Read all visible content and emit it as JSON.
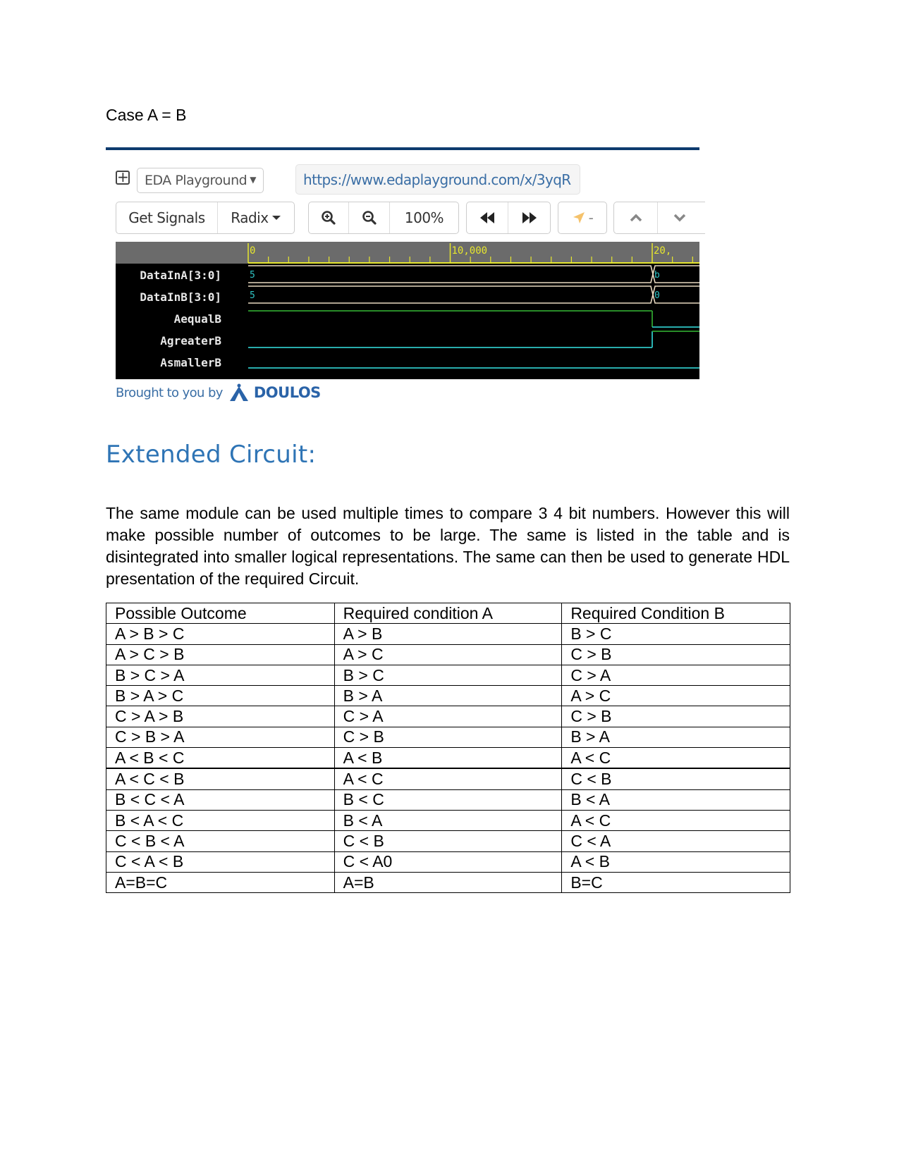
{
  "case_title": "Case A = B",
  "eda": {
    "menu_icon": "expand-plus-icon",
    "site_select": {
      "value": "EDA Playground",
      "caret": "▼"
    },
    "url": "https://www.edaplayground.com/x/3yqR",
    "toolbar": {
      "get_signals": "Get Signals",
      "radix": "Radix",
      "zoom_in_icon": "zoom-in-icon",
      "zoom_out_icon": "zoom-out-icon",
      "zoom_level": "100%",
      "rewind_icon": "rewind-icon",
      "fast_forward_icon": "fast-forward-icon",
      "marker_label": "-",
      "up_icon": "chevron-up-icon",
      "down_icon": "chevron-down-icon"
    },
    "waveform": {
      "ruler_ticks": [
        "0",
        "10,000",
        "20,"
      ],
      "signals": [
        {
          "name": "DataInA[3:0]",
          "type": "bus",
          "values": [
            "5",
            "b"
          ]
        },
        {
          "name": "DataInB[3:0]",
          "type": "bus",
          "values": [
            "5",
            "0"
          ]
        },
        {
          "name": "AequalB",
          "type": "bit",
          "levels": [
            1,
            0
          ]
        },
        {
          "name": "AgreaterB",
          "type": "bit",
          "levels": [
            0,
            1
          ]
        },
        {
          "name": "AsmallerB",
          "type": "bit",
          "levels": [
            0,
            0
          ]
        }
      ],
      "colors": {
        "bus": "#e8d9c0",
        "high": "#2ea02e",
        "low": "#2ec4c4",
        "value": "#2ec4c4",
        "ruler": "#e6e62e"
      }
    },
    "footer": {
      "text": "Brought to you by",
      "brand": "DOULOS"
    }
  },
  "heading": "Extended Circuit:",
  "paragraph": "The same module can be used multiple times to compare 3 4 bit numbers. However this will make possible number of outcomes to be large. The same is listed in the table and is disintegrated into smaller logical representations. The same can then be used to generate HDL presentation of the required Circuit.",
  "table": {
    "headers": [
      "Possible Outcome",
      "Required condition A",
      "Required Condition B"
    ],
    "rows": [
      [
        "A > B > C",
        "A > B",
        "B > C"
      ],
      [
        "A > C > B",
        "A > C",
        "C > B"
      ],
      [
        "B > C > A",
        "B > C",
        "C > A"
      ],
      [
        "B > A > C",
        "B > A",
        "A > C"
      ],
      [
        "C > A > B",
        "C > A",
        "C > B"
      ],
      [
        "C > B > A",
        "C > B",
        "B > A"
      ],
      [
        "A < B < C",
        "A < B",
        "A < C"
      ],
      [
        "A < C < B",
        "A < C",
        "C < B"
      ],
      [
        "B < C < A",
        "B < C",
        "B < A"
      ],
      [
        "B < A < C",
        "B < A",
        "A < C"
      ],
      [
        "C < B < A",
        "C < B",
        "C < A"
      ],
      [
        "C < A < B",
        "C < A0",
        "A < B"
      ],
      [
        "A=B=C",
        "A=B",
        "B=C"
      ]
    ]
  }
}
